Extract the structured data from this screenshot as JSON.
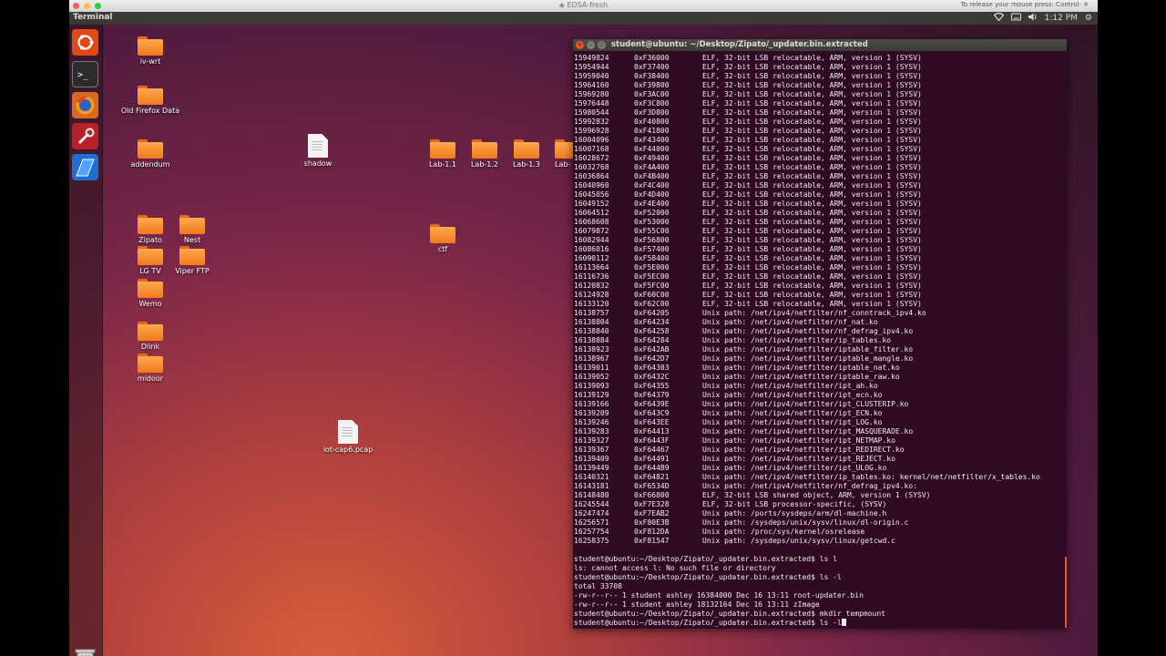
{
  "mac": {
    "title": "EDSA-fresh",
    "hint": "To release your mouse press: Control-"
  },
  "panel": {
    "app_name": "Terminal",
    "time": "1:12 PM"
  },
  "launcher": {
    "items": [
      "ubuntu-dash",
      "terminal",
      "firefox",
      "settings",
      "virtualbox"
    ]
  },
  "desktop": {
    "icons": [
      {
        "label": "iv-wrt",
        "kind": "folder"
      },
      {
        "label": "Old Firefox Data",
        "kind": "folder"
      },
      {
        "label": "addendum",
        "kind": "folder"
      },
      {
        "label": "shadow",
        "kind": "file"
      },
      {
        "label": "Lab-1.1",
        "kind": "folder"
      },
      {
        "label": "Lab-1.2",
        "kind": "folder"
      },
      {
        "label": "Lab-1.3",
        "kind": "folder"
      },
      {
        "label": "Lab-",
        "kind": "folder"
      },
      {
        "label": "Zipato",
        "kind": "folder"
      },
      {
        "label": "Nest",
        "kind": "folder"
      },
      {
        "label": "LG TV",
        "kind": "folder"
      },
      {
        "label": "Viper FTP",
        "kind": "folder"
      },
      {
        "label": "ctf",
        "kind": "folder"
      },
      {
        "label": "Wemo",
        "kind": "folder"
      },
      {
        "label": "Dlink",
        "kind": "folder"
      },
      {
        "label": "midoor",
        "kind": "folder"
      },
      {
        "label": "iot-cap6.pcap",
        "kind": "file"
      }
    ]
  },
  "terminal": {
    "title": "student@ubuntu: ~/Desktop/Zipato/_updater.bin.extracted",
    "rows": [
      [
        "15949824",
        "0xF36000",
        "ELF, 32-bit LSB relocatable, ARM, version 1 (SYSV)"
      ],
      [
        "15954944",
        "0xF37400",
        "ELF, 32-bit LSB relocatable, ARM, version 1 (SYSV)"
      ],
      [
        "15959040",
        "0xF38400",
        "ELF, 32-bit LSB relocatable, ARM, version 1 (SYSV)"
      ],
      [
        "15964160",
        "0xF39800",
        "ELF, 32-bit LSB relocatable, ARM, version 1 (SYSV)"
      ],
      [
        "15969280",
        "0xF3AC00",
        "ELF, 32-bit LSB relocatable, ARM, version 1 (SYSV)"
      ],
      [
        "15976448",
        "0xF3C800",
        "ELF, 32-bit LSB relocatable, ARM, version 1 (SYSV)"
      ],
      [
        "15980544",
        "0xF3D800",
        "ELF, 32-bit LSB relocatable, ARM, version 1 (SYSV)"
      ],
      [
        "15992832",
        "0xF40800",
        "ELF, 32-bit LSB relocatable, ARM, version 1 (SYSV)"
      ],
      [
        "15996928",
        "0xF41800",
        "ELF, 32-bit LSB relocatable, ARM, version 1 (SYSV)"
      ],
      [
        "16004096",
        "0xF43400",
        "ELF, 32-bit LSB relocatable, ARM, version 1 (SYSV)"
      ],
      [
        "16007168",
        "0xF44000",
        "ELF, 32-bit LSB relocatable, ARM, version 1 (SYSV)"
      ],
      [
        "16028672",
        "0xF49400",
        "ELF, 32-bit LSB relocatable, ARM, version 1 (SYSV)"
      ],
      [
        "16032768",
        "0xF4A400",
        "ELF, 32-bit LSB relocatable, ARM, version 1 (SYSV)"
      ],
      [
        "16036864",
        "0xF4B400",
        "ELF, 32-bit LSB relocatable, ARM, version 1 (SYSV)"
      ],
      [
        "16040960",
        "0xF4C400",
        "ELF, 32-bit LSB relocatable, ARM, version 1 (SYSV)"
      ],
      [
        "16045056",
        "0xF4D400",
        "ELF, 32-bit LSB relocatable, ARM, version 1 (SYSV)"
      ],
      [
        "16049152",
        "0xF4E400",
        "ELF, 32-bit LSB relocatable, ARM, version 1 (SYSV)"
      ],
      [
        "16064512",
        "0xF52000",
        "ELF, 32-bit LSB relocatable, ARM, version 1 (SYSV)"
      ],
      [
        "16068608",
        "0xF53000",
        "ELF, 32-bit LSB relocatable, ARM, version 1 (SYSV)"
      ],
      [
        "16079872",
        "0xF55C00",
        "ELF, 32-bit LSB relocatable, ARM, version 1 (SYSV)"
      ],
      [
        "16082944",
        "0xF56800",
        "ELF, 32-bit LSB relocatable, ARM, version 1 (SYSV)"
      ],
      [
        "16086016",
        "0xF57400",
        "ELF, 32-bit LSB relocatable, ARM, version 1 (SYSV)"
      ],
      [
        "16090112",
        "0xF58400",
        "ELF, 32-bit LSB relocatable, ARM, version 1 (SYSV)"
      ],
      [
        "16113664",
        "0xF5E000",
        "ELF, 32-bit LSB relocatable, ARM, version 1 (SYSV)"
      ],
      [
        "16116736",
        "0xF5EC00",
        "ELF, 32-bit LSB relocatable, ARM, version 1 (SYSV)"
      ],
      [
        "16120832",
        "0xF5FC00",
        "ELF, 32-bit LSB relocatable, ARM, version 1 (SYSV)"
      ],
      [
        "16124928",
        "0xF60C00",
        "ELF, 32-bit LSB relocatable, ARM, version 1 (SYSV)"
      ],
      [
        "16133120",
        "0xF62C00",
        "ELF, 32-bit LSB relocatable, ARM, version 1 (SYSV)"
      ],
      [
        "16138757",
        "0xF64205",
        "Unix path: /net/ipv4/netfilter/nf_conntrack_ipv4.ko"
      ],
      [
        "16138804",
        "0xF64234",
        "Unix path: /net/ipv4/netfilter/nf_nat.ko"
      ],
      [
        "16138840",
        "0xF64258",
        "Unix path: /net/ipv4/netfilter/nf_defrag_ipv4.ko"
      ],
      [
        "16138884",
        "0xF64284",
        "Unix path: /net/ipv4/netfilter/ip_tables.ko"
      ],
      [
        "16138923",
        "0xF642AB",
        "Unix path: /net/ipv4/netfilter/iptable_filter.ko"
      ],
      [
        "16138967",
        "0xF642D7",
        "Unix path: /net/ipv4/netfilter/iptable_mangle.ko"
      ],
      [
        "16139011",
        "0xF64303",
        "Unix path: /net/ipv4/netfilter/iptable_nat.ko"
      ],
      [
        "16139052",
        "0xF6432C",
        "Unix path: /net/ipv4/netfilter/iptable_raw.ko"
      ],
      [
        "16139093",
        "0xF64355",
        "Unix path: /net/ipv4/netfilter/ipt_ah.ko"
      ],
      [
        "16139129",
        "0xF64379",
        "Unix path: /net/ipv4/netfilter/ipt_ecn.ko"
      ],
      [
        "16139166",
        "0xF6439E",
        "Unix path: /net/ipv4/netfilter/ipt_CLUSTERIP.ko"
      ],
      [
        "16139209",
        "0xF643C9",
        "Unix path: /net/ipv4/netfilter/ipt_ECN.ko"
      ],
      [
        "16139246",
        "0xF643EE",
        "Unix path: /net/ipv4/netfilter/ipt_LOG.ko"
      ],
      [
        "16139283",
        "0xF64413",
        "Unix path: /net/ipv4/netfilter/ipt_MASQUERADE.ko"
      ],
      [
        "16139327",
        "0xF6443F",
        "Unix path: /net/ipv4/netfilter/ipt_NETMAP.ko"
      ],
      [
        "16139367",
        "0xF64467",
        "Unix path: /net/ipv4/netfilter/ipt_REDIRECT.ko"
      ],
      [
        "16139409",
        "0xF64491",
        "Unix path: /net/ipv4/netfilter/ipt_REJECT.ko"
      ],
      [
        "16139449",
        "0xF644B9",
        "Unix path: /net/ipv4/netfilter/ipt_ULOG.ko"
      ],
      [
        "16140321",
        "0xF64821",
        "Unix path: /net/ipv4/netfilter/ip_tables.ko: kernel/net/netfilter/x_tables.ko"
      ],
      [
        "16143181",
        "0xF6534D",
        "Unix path: /net/ipv4/netfilter/nf_defrag_ipv4.ko:"
      ],
      [
        "16148480",
        "0xF66800",
        "ELF, 32-bit LSB shared object, ARM, version 1 (SYSV)"
      ],
      [
        "16245544",
        "0xF7E328",
        "ELF, 32-bit LSB processor-specific, (SYSV)"
      ],
      [
        "16247474",
        "0xF7EAB2",
        "Unix path: /ports/sysdeps/arm/dl-machine.h"
      ],
      [
        "16256571",
        "0xF80E3B",
        "Unix path: /sysdeps/unix/sysv/linux/dl-origin.c"
      ],
      [
        "16257754",
        "0xF812DA",
        "Unix path: /proc/sys/kernel/osrelease"
      ],
      [
        "16258375",
        "0xF81547",
        "Unix path: /sysdeps/unix/sysv/linux/getcwd.c"
      ]
    ],
    "tail": [
      "",
      "student@ubuntu:~/Desktop/Zipato/_updater.bin.extracted$ ls l",
      "ls: cannot access l: No such file or directory",
      "student@ubuntu:~/Desktop/Zipato/_updater.bin.extracted$ ls -l",
      "total 33708",
      "-rw-r--r-- 1 student ashley 16384000 Dec 16 13:11 root-updater.bin",
      "-rw-r--r-- 1 student ashley 18132164 Dec 16 13:11 zImage",
      "student@ubuntu:~/Desktop/Zipato/_updater.bin.extracted$ mkdir tempmount"
    ],
    "prompt": "student@ubuntu:~/Desktop/Zipato/_updater.bin.extracted$ ls -l"
  },
  "colors": {
    "terminal_bg": "#300a24",
    "accent": "#e95420",
    "folder": "#f58a2a"
  }
}
